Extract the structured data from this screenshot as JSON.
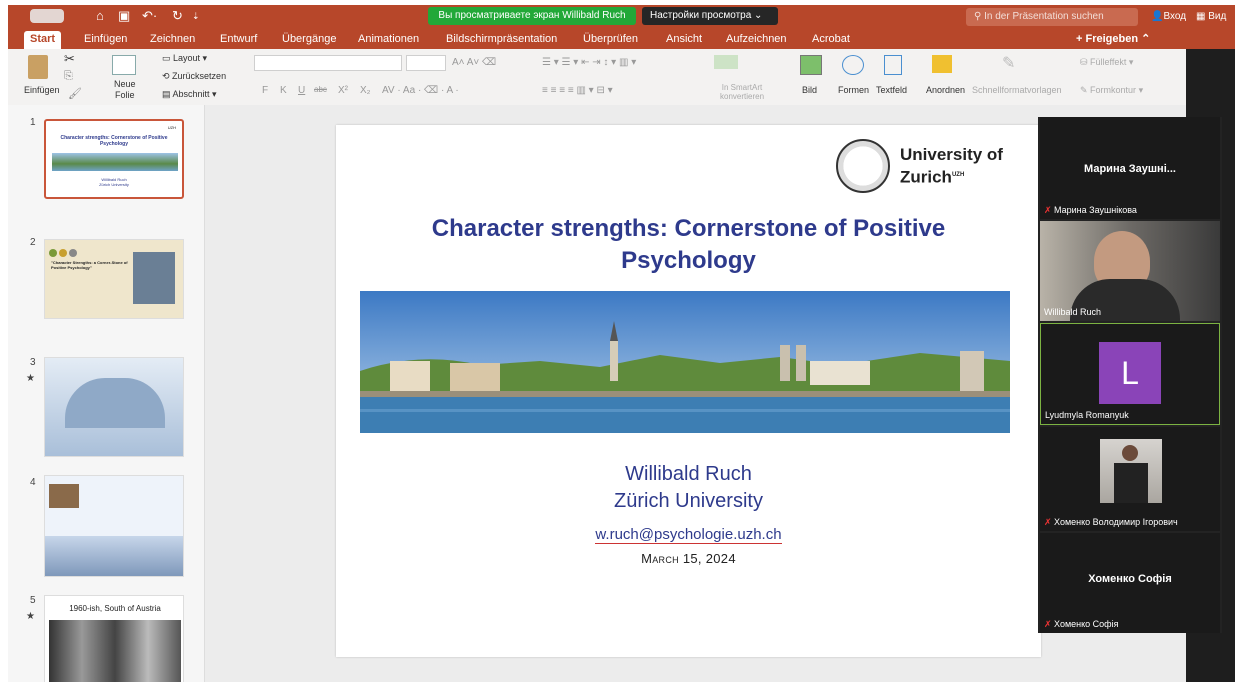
{
  "titlebar": {
    "share_banner": "Вы просматриваете экран Willibald Ruch",
    "view_options": "Настройки просмотра ⌄",
    "search_placeholder": "In der Präsentation suchen",
    "login": "Вход",
    "view": "Вид"
  },
  "tabs": [
    "Start",
    "Einfügen",
    "Zeichnen",
    "Entwurf",
    "Übergänge",
    "Animationen",
    "Bildschirmpräsentation",
    "Überprüfen",
    "Ansicht",
    "Aufzeichnen",
    "Acrobat"
  ],
  "share_label": "Freigeben",
  "ribbon": {
    "paste": "Einfügen",
    "new_slide": "Neue\nFolie",
    "layout": "Layout",
    "reset": "Zurücksetzen",
    "section": "Abschnitt",
    "smartart": "In SmartArt\nkonvertieren",
    "picture": "Bild",
    "shapes": "Formen",
    "textbox": "Textfeld",
    "arrange": "Anordnen",
    "quick_styles": "Schnellformatvorlagen",
    "fill": "Fülleffekt",
    "outline": "Formkontur",
    "format_buttons": [
      "F",
      "K",
      "U",
      "abc",
      "X²",
      "X₂"
    ]
  },
  "thumbnails": [
    {
      "num": "1",
      "title": "Character strengths:  Cornerstone of Positive Psychology"
    },
    {
      "num": "2",
      "title": "\"Character Strengths: a Corner-Stone of Positive Psychology\""
    },
    {
      "num": "3",
      "star": "★"
    },
    {
      "num": "4",
      "star": ""
    },
    {
      "num": "5",
      "star": "★",
      "title": "1960-ish, South of Austria"
    }
  ],
  "slide": {
    "title": "Character strengths:  Cornerstone of Positive Psychology",
    "name": "Willibald Ruch",
    "university": "Zürich University",
    "email": "w.ruch@psychologie.uzh.ch",
    "date": "March 15, 2024",
    "logo_text": "University of",
    "logo_text2": "Zurich"
  },
  "participants": [
    {
      "big_name": "Марина  Заушні...",
      "label": "Марина Заушнікова",
      "muted": true
    },
    {
      "label": "Willibald Ruch",
      "muted": false
    },
    {
      "initial": "L",
      "label": "Lyudmyla Romanyuk",
      "muted": false
    },
    {
      "label": "Хоменко Володимир Ігорович",
      "muted": true
    },
    {
      "big_name": "Хоменко Софія",
      "label": "Хоменко Софія",
      "muted": true
    }
  ]
}
